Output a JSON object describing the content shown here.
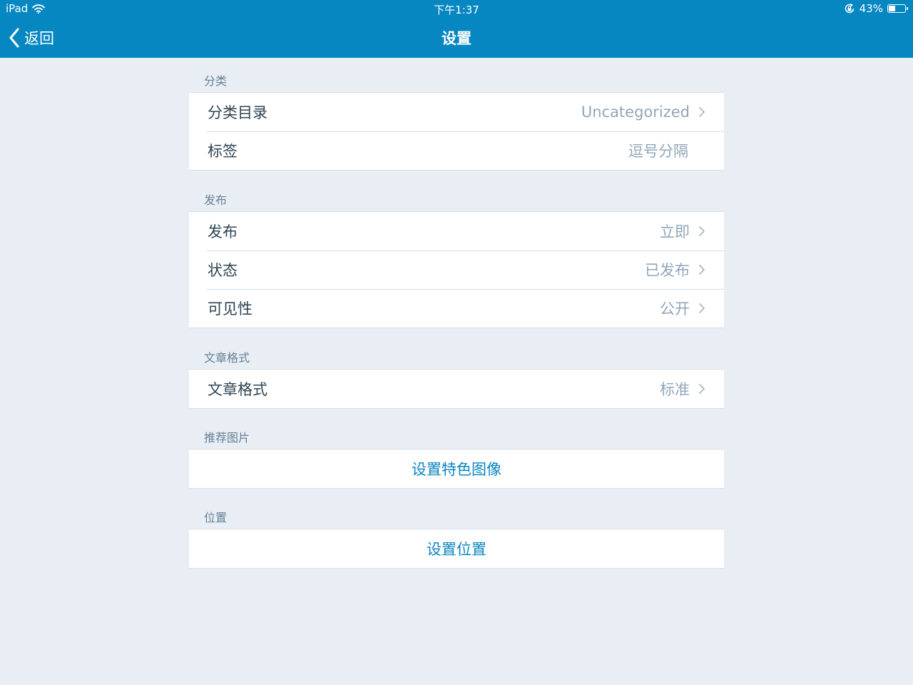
{
  "status_bar": {
    "device": "iPad",
    "time": "下午1:37",
    "battery_percent": "43%",
    "battery_level": 0.43
  },
  "nav": {
    "back_label": "返回",
    "title": "设置"
  },
  "sections": {
    "category": {
      "header": "分类",
      "rows": [
        {
          "label": "分类目录",
          "value": "Uncategorized"
        },
        {
          "label": "标签",
          "value": "逗号分隔"
        }
      ]
    },
    "publish": {
      "header": "发布",
      "rows": [
        {
          "label": "发布",
          "value": "立即"
        },
        {
          "label": "状态",
          "value": "已发布"
        },
        {
          "label": "可见性",
          "value": "公开"
        }
      ]
    },
    "format": {
      "header": "文章格式",
      "rows": [
        {
          "label": "文章格式",
          "value": "标准"
        }
      ]
    },
    "featured_image": {
      "header": "推荐图片",
      "action": "设置特色图像"
    },
    "location": {
      "header": "位置",
      "action": "设置位置"
    }
  },
  "colors": {
    "nav_background": "#0687c1",
    "page_background": "#e8eef4",
    "label_text": "#2e4453",
    "value_text": "#92a6b8",
    "action_text": "#0a86c2",
    "section_header_text": "#667f95"
  },
  "icons": {
    "wifi": "wifi-icon",
    "rotation_lock": "rotation-lock-icon",
    "battery": "battery-icon",
    "back": "chevron-left-icon",
    "disclosure": "chevron-right-icon"
  }
}
